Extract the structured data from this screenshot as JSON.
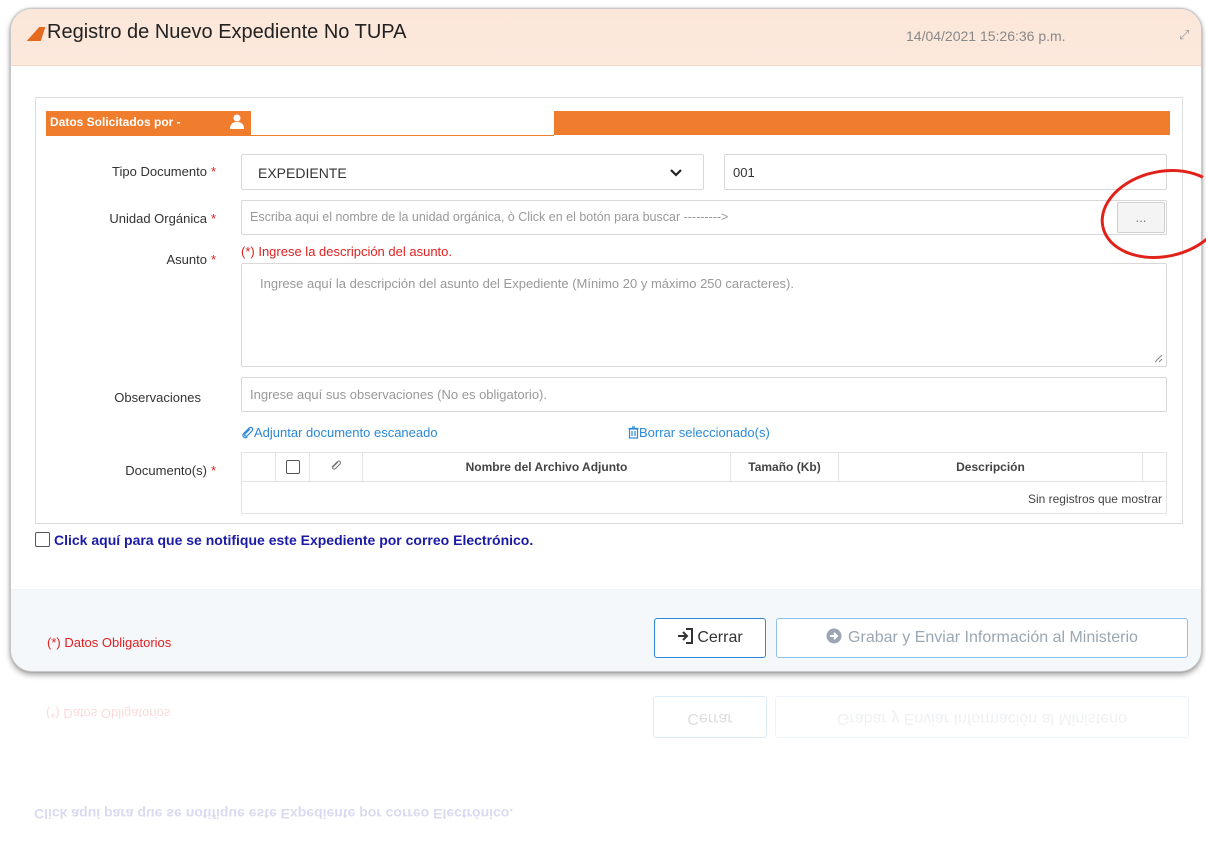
{
  "header": {
    "title": "Registro de Nuevo Expediente No TUPA",
    "datetime": "14/04/2021 15:26:36 p.m."
  },
  "section": {
    "title": "Datos Solicitados por -"
  },
  "form": {
    "tipo_documento": {
      "label": "Tipo Documento",
      "required_mark": "*",
      "value": "EXPEDIENTE",
      "number": "001"
    },
    "unidad_organica": {
      "label": "Unidad Orgánica",
      "required_mark": "*",
      "placeholder": "Escriba aqui el nombre de la unidad orgánica, ò Click en el botón para buscar --------->",
      "search_button": "..."
    },
    "asunto": {
      "label": "Asunto",
      "required_mark": "*",
      "hint": "(*) Ingrese la descripción del asunto.",
      "placeholder": "Ingrese aquí la descripción del asunto del Expediente (Mínimo 20 y máximo 250 caracteres)."
    },
    "observaciones": {
      "label": "Observaciones",
      "placeholder": "Ingrese aquí sus observaciones (No es obligatorio)."
    },
    "links": {
      "adjuntar": "Adjuntar documento escaneado",
      "borrar": "Borrar seleccionado(s)"
    },
    "documentos": {
      "label": "Documento(s)",
      "required_mark": "*",
      "columns": [
        "Nombre del Archivo Adjunto",
        "Tamaño (Kb)",
        "Descripción"
      ],
      "empty_text": "Sin registros que mostrar"
    }
  },
  "notify": {
    "label": "Click aquí para que se notifique este Expediente por correo Electrónico."
  },
  "footer": {
    "required_note": "(*) Datos Obligatorios",
    "close_label": "Cerrar",
    "submit_label": "Grabar y Enviar Información al Ministerio"
  },
  "colors": {
    "accent": "#f07c2e",
    "header_bg": "#fde8dc",
    "link": "#2b88d8",
    "required": "#e02020",
    "annotation": "#e0221b"
  }
}
